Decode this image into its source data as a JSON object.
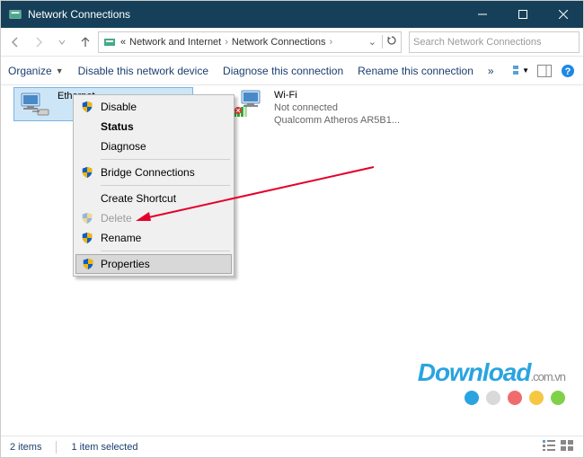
{
  "window": {
    "title": "Network Connections"
  },
  "breadcrumb": {
    "prefix": "«",
    "item1": "Network and Internet",
    "item2": "Network Connections"
  },
  "search": {
    "placeholder": "Search Network Connections"
  },
  "toolbar": {
    "organize": "Organize",
    "disable": "Disable this network device",
    "diagnose": "Diagnose this connection",
    "rename": "Rename this connection",
    "overflow": "»"
  },
  "adapters": {
    "ethernet": {
      "name": "Ethernet"
    },
    "wifi": {
      "name": "Wi-Fi",
      "status": "Not connected",
      "desc": "Qualcomm Atheros AR5B1..."
    }
  },
  "contextMenu": {
    "disable": "Disable",
    "status": "Status",
    "diagnose": "Diagnose",
    "bridge": "Bridge Connections",
    "shortcut": "Create Shortcut",
    "delete": "Delete",
    "rename": "Rename",
    "properties": "Properties"
  },
  "statusbar": {
    "count": "2 items",
    "selected": "1 item selected"
  },
  "watermark": {
    "main": "Download",
    "suffix": ".com.vn",
    "dots": [
      "#2aa4e0",
      "#d9d9d9",
      "#f06c6c",
      "#f5c742",
      "#7fd14a"
    ]
  }
}
